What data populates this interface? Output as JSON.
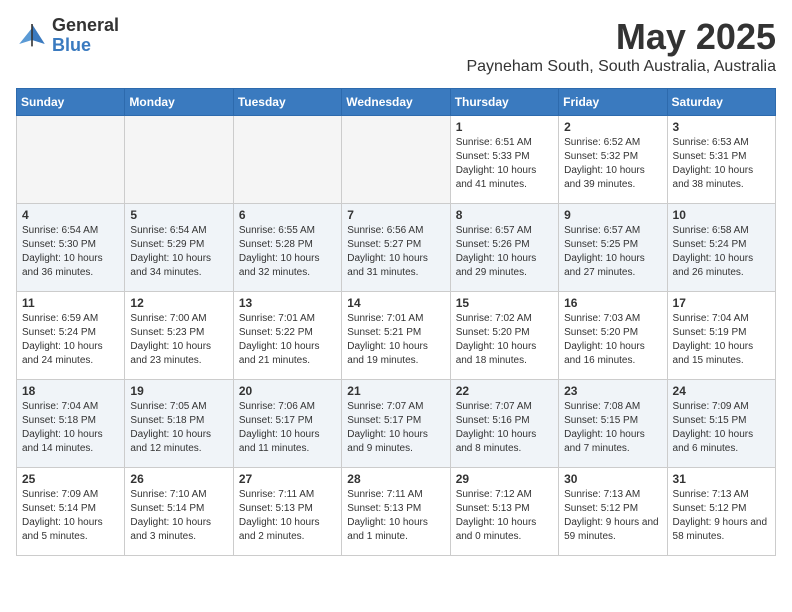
{
  "logo": {
    "general": "General",
    "blue": "Blue"
  },
  "title": "May 2025",
  "subtitle": "Payneham South, South Australia, Australia",
  "days_header": [
    "Sunday",
    "Monday",
    "Tuesday",
    "Wednesday",
    "Thursday",
    "Friday",
    "Saturday"
  ],
  "weeks": [
    [
      {
        "day": "",
        "content": ""
      },
      {
        "day": "",
        "content": ""
      },
      {
        "day": "",
        "content": ""
      },
      {
        "day": "",
        "content": ""
      },
      {
        "day": "1",
        "sunrise": "6:51 AM",
        "sunset": "5:33 PM",
        "daylight": "10 hours and 41 minutes."
      },
      {
        "day": "2",
        "sunrise": "6:52 AM",
        "sunset": "5:32 PM",
        "daylight": "10 hours and 39 minutes."
      },
      {
        "day": "3",
        "sunrise": "6:53 AM",
        "sunset": "5:31 PM",
        "daylight": "10 hours and 38 minutes."
      }
    ],
    [
      {
        "day": "4",
        "sunrise": "6:54 AM",
        "sunset": "5:30 PM",
        "daylight": "10 hours and 36 minutes."
      },
      {
        "day": "5",
        "sunrise": "6:54 AM",
        "sunset": "5:29 PM",
        "daylight": "10 hours and 34 minutes."
      },
      {
        "day": "6",
        "sunrise": "6:55 AM",
        "sunset": "5:28 PM",
        "daylight": "10 hours and 32 minutes."
      },
      {
        "day": "7",
        "sunrise": "6:56 AM",
        "sunset": "5:27 PM",
        "daylight": "10 hours and 31 minutes."
      },
      {
        "day": "8",
        "sunrise": "6:57 AM",
        "sunset": "5:26 PM",
        "daylight": "10 hours and 29 minutes."
      },
      {
        "day": "9",
        "sunrise": "6:57 AM",
        "sunset": "5:25 PM",
        "daylight": "10 hours and 27 minutes."
      },
      {
        "day": "10",
        "sunrise": "6:58 AM",
        "sunset": "5:24 PM",
        "daylight": "10 hours and 26 minutes."
      }
    ],
    [
      {
        "day": "11",
        "sunrise": "6:59 AM",
        "sunset": "5:24 PM",
        "daylight": "10 hours and 24 minutes."
      },
      {
        "day": "12",
        "sunrise": "7:00 AM",
        "sunset": "5:23 PM",
        "daylight": "10 hours and 23 minutes."
      },
      {
        "day": "13",
        "sunrise": "7:01 AM",
        "sunset": "5:22 PM",
        "daylight": "10 hours and 21 minutes."
      },
      {
        "day": "14",
        "sunrise": "7:01 AM",
        "sunset": "5:21 PM",
        "daylight": "10 hours and 19 minutes."
      },
      {
        "day": "15",
        "sunrise": "7:02 AM",
        "sunset": "5:20 PM",
        "daylight": "10 hours and 18 minutes."
      },
      {
        "day": "16",
        "sunrise": "7:03 AM",
        "sunset": "5:20 PM",
        "daylight": "10 hours and 16 minutes."
      },
      {
        "day": "17",
        "sunrise": "7:04 AM",
        "sunset": "5:19 PM",
        "daylight": "10 hours and 15 minutes."
      }
    ],
    [
      {
        "day": "18",
        "sunrise": "7:04 AM",
        "sunset": "5:18 PM",
        "daylight": "10 hours and 14 minutes."
      },
      {
        "day": "19",
        "sunrise": "7:05 AM",
        "sunset": "5:18 PM",
        "daylight": "10 hours and 12 minutes."
      },
      {
        "day": "20",
        "sunrise": "7:06 AM",
        "sunset": "5:17 PM",
        "daylight": "10 hours and 11 minutes."
      },
      {
        "day": "21",
        "sunrise": "7:07 AM",
        "sunset": "5:17 PM",
        "daylight": "10 hours and 9 minutes."
      },
      {
        "day": "22",
        "sunrise": "7:07 AM",
        "sunset": "5:16 PM",
        "daylight": "10 hours and 8 minutes."
      },
      {
        "day": "23",
        "sunrise": "7:08 AM",
        "sunset": "5:15 PM",
        "daylight": "10 hours and 7 minutes."
      },
      {
        "day": "24",
        "sunrise": "7:09 AM",
        "sunset": "5:15 PM",
        "daylight": "10 hours and 6 minutes."
      }
    ],
    [
      {
        "day": "25",
        "sunrise": "7:09 AM",
        "sunset": "5:14 PM",
        "daylight": "10 hours and 5 minutes."
      },
      {
        "day": "26",
        "sunrise": "7:10 AM",
        "sunset": "5:14 PM",
        "daylight": "10 hours and 3 minutes."
      },
      {
        "day": "27",
        "sunrise": "7:11 AM",
        "sunset": "5:13 PM",
        "daylight": "10 hours and 2 minutes."
      },
      {
        "day": "28",
        "sunrise": "7:11 AM",
        "sunset": "5:13 PM",
        "daylight": "10 hours and 1 minute."
      },
      {
        "day": "29",
        "sunrise": "7:12 AM",
        "sunset": "5:13 PM",
        "daylight": "10 hours and 0 minutes."
      },
      {
        "day": "30",
        "sunrise": "7:13 AM",
        "sunset": "5:12 PM",
        "daylight": "9 hours and 59 minutes."
      },
      {
        "day": "31",
        "sunrise": "7:13 AM",
        "sunset": "5:12 PM",
        "daylight": "9 hours and 58 minutes."
      }
    ]
  ]
}
